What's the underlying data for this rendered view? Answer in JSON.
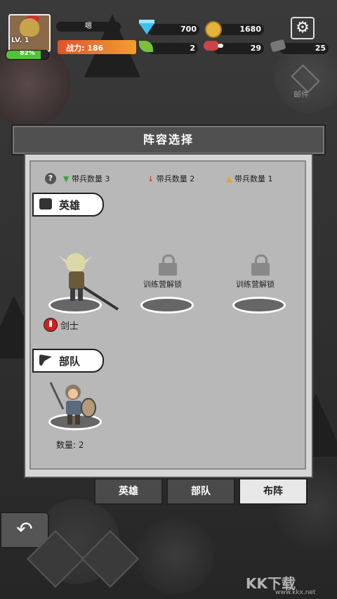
{
  "hud": {
    "level": "LV. 1",
    "exp_percent": "82%",
    "exp_fraction": 0.82,
    "player_name": "嗯",
    "power_label": "战力: 186",
    "gems": "700",
    "gold": "1680",
    "leaf": "2",
    "meat": "29",
    "ore": "25",
    "settings_icon": "gear-icon",
    "mail_label": "邮件"
  },
  "panel": {
    "title": "阵容选择",
    "legend": [
      {
        "label": "带兵数量 3",
        "icon": "green-arrow-icon",
        "color": "#3aa53a"
      },
      {
        "label": "带兵数量 2",
        "icon": "red-arrow-icon",
        "color": "#d22a2a"
      },
      {
        "label": "带兵数量 1",
        "icon": "yellow-arrow-icon",
        "color": "#d9a62a"
      }
    ],
    "help_icon": "?",
    "hero_section": "英雄",
    "hero_slots": [
      {
        "name": "剑士",
        "type": "hero"
      },
      {
        "locked_text": "训练营解锁"
      },
      {
        "locked_text": "训练营解锁"
      }
    ],
    "troop_section": "部队",
    "troop_count": "数量: 2"
  },
  "tabs": [
    "英雄",
    "部队",
    "布阵"
  ],
  "active_tab": "布阵",
  "watermark": "KK下载",
  "watermark_url": "www.kkx.net"
}
